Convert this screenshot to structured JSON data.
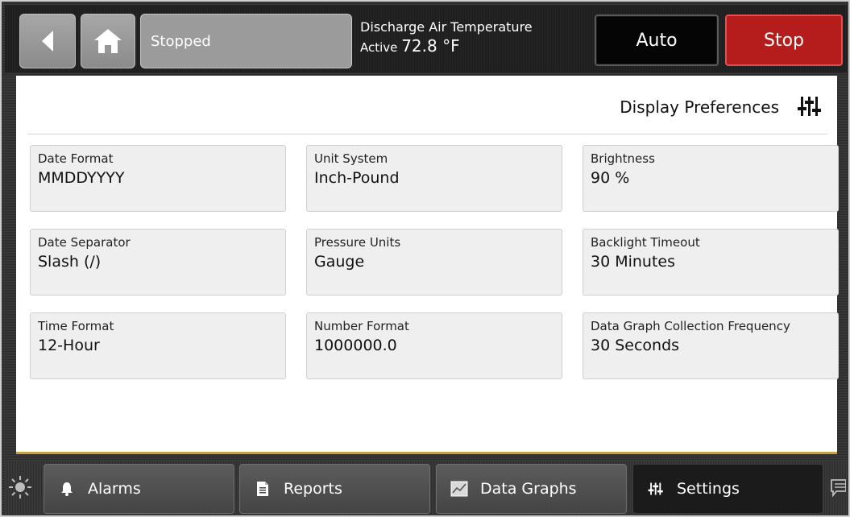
{
  "header": {
    "status": "Stopped",
    "point_name": "Discharge Air Temperature",
    "point_state": "Active",
    "point_value": "72.8 °F",
    "auto_label": "Auto",
    "stop_label": "Stop"
  },
  "page": {
    "title": "Display Preferences"
  },
  "settings": [
    {
      "label": "Date Format",
      "value": "MMDDYYYY"
    },
    {
      "label": "Unit System",
      "value": "Inch-Pound"
    },
    {
      "label": "Brightness",
      "value": "90 %"
    },
    {
      "label": "Date Separator",
      "value": "Slash (/)"
    },
    {
      "label": "Pressure Units",
      "value": "Gauge"
    },
    {
      "label": "Backlight Timeout",
      "value": "30 Minutes"
    },
    {
      "label": "Time Format",
      "value": "12-Hour"
    },
    {
      "label": "Number Format",
      "value": "1000000.0"
    },
    {
      "label": "Data Graph Collection Frequency",
      "value": "30 Seconds"
    }
  ],
  "nav": {
    "alarms": "Alarms",
    "reports": "Reports",
    "data_graphs": "Data Graphs",
    "settings": "Settings"
  },
  "colors": {
    "stop": "#b51d1d",
    "accent_line": "#c9a33a"
  }
}
